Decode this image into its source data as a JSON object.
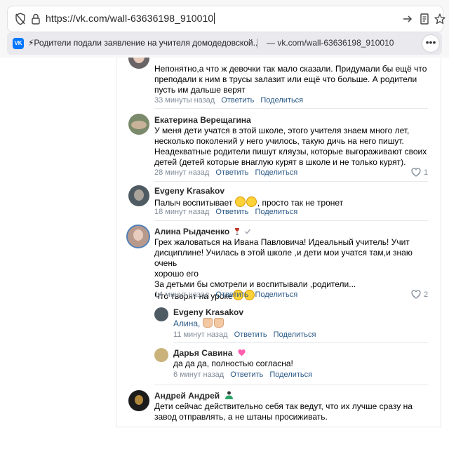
{
  "browser": {
    "url": "https://vk.com/wall-63636198_910010",
    "suggestion_title": "⚡Родители подали заявление на учителя домодедовской...",
    "suggestion_url": "vk.com/wall-63636198_910010",
    "more": "•••"
  },
  "actions": {
    "reply": "Ответить",
    "share": "Поделиться"
  },
  "comments": [
    {
      "author": "",
      "text": "Непонятно,а что ж девочки так мало сказали. Придумали бы ещё что преподали к ним в трусы залазит или ещё что больше. А родители пусть им дальше верят",
      "time": "33 минуты назад"
    },
    {
      "author": "Екатерина Верещагина",
      "text": "У меня дети учатся в этой школе, этого учителя знаем много лет, несколько поколений у него училось, такую дичь на него пишут. Неадекватные родители пишут кляузы, которые выгораживают своих детей (детей которые внаглую курят в школе и не только курят).",
      "time": "28 минут назад",
      "likes": "1"
    },
    {
      "author": "Evgeny Krasakov",
      "text": "Палыч воспитывает",
      "text_tail": ", просто так не тронет",
      "time": "18 минут назад"
    },
    {
      "author": "Алина Рыдаченко",
      "text_lines": [
        "Грех жаловаться на Ивана Павловича! Идеальный учитель! Учит",
        "дисциплине! Училась в этой школе ,и дети мои учатся там,и знаю очень",
        "хорошо его",
        "За детьми бы смотрели и воспитывали ,родители...",
        "Что творят на уроке"
      ],
      "time": "14 минут назад",
      "likes": "2"
    },
    {
      "author": "Evgeny Krasakov",
      "mention": "Алина,",
      "time": "11 минут назад"
    },
    {
      "author": "Дарья Савина",
      "text": "да да да, полностью согласна!",
      "time": "6 минут назад"
    },
    {
      "author": "Андрей Андрей",
      "text": "Дети сейчас действительно себя так ведут, что их лучше сразу на завод отправлять, а не штаны просиживать."
    }
  ],
  "colors": {
    "link": "#2a5885",
    "meta": "#818c99",
    "divider": "#e7e8ec",
    "vk_blue": "#0077ff"
  }
}
